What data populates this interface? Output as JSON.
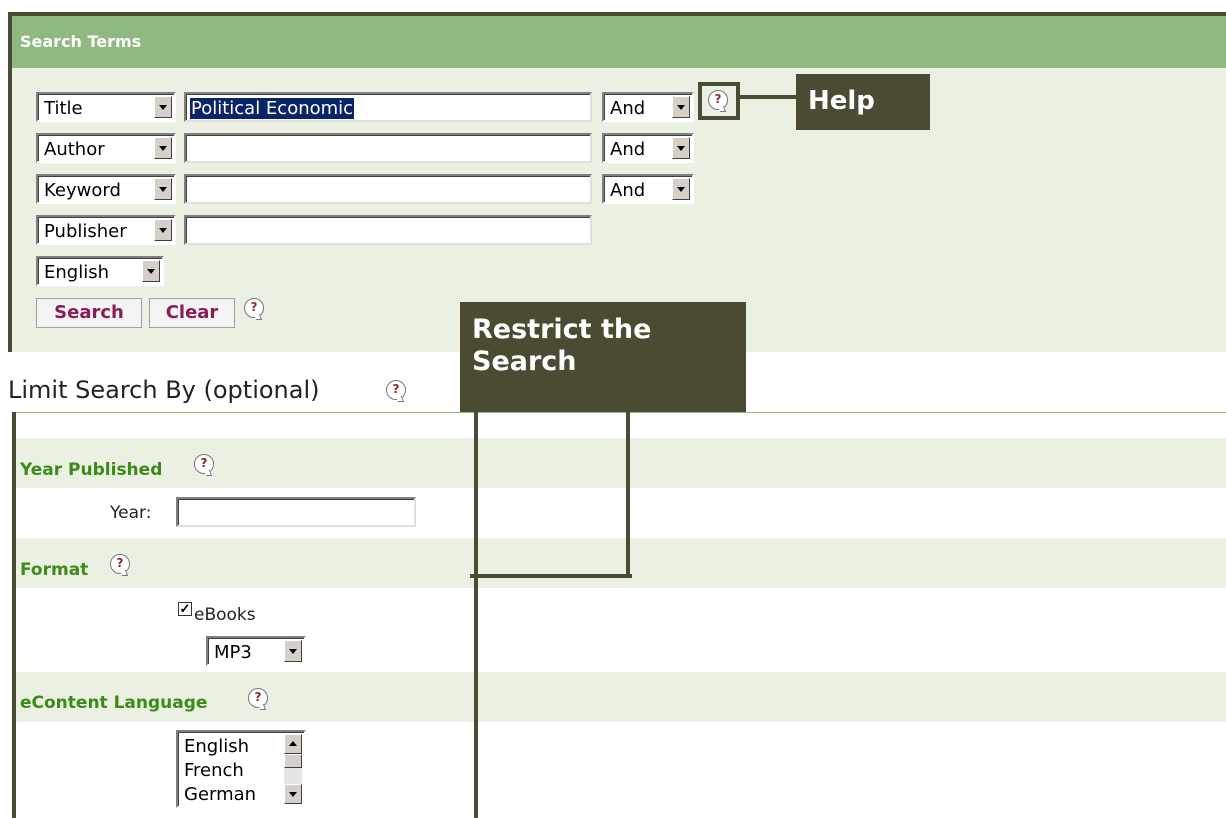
{
  "search_terms": {
    "title": "Search Terms",
    "rows": [
      {
        "field": "Title",
        "value": "Political Economic",
        "operator": "And"
      },
      {
        "field": "Author",
        "value": "",
        "operator": "And"
      },
      {
        "field": "Keyword",
        "value": "",
        "operator": "And"
      },
      {
        "field": "Publisher",
        "value": ""
      }
    ],
    "language": "English",
    "search_label": "Search",
    "clear_label": "Clear"
  },
  "callouts": {
    "help": "Help",
    "restrict_line1": "Restrict the",
    "restrict_line2": "Search"
  },
  "limit": {
    "title": "Limit Search By (optional)",
    "year_published": {
      "label": "Year Published",
      "year_label": "Year:",
      "year_value": ""
    },
    "format": {
      "label": "Format",
      "ebooks_label": "eBooks",
      "ebooks_checked": true,
      "type": "MP3"
    },
    "econtent_language": {
      "label": "eContent Language",
      "options": [
        "English",
        "French",
        "German"
      ]
    }
  },
  "colors": {
    "header_green": "#8fb981",
    "panel_bg": "#eaf1e2",
    "callout_bg": "#4a4b32",
    "section_label": "#3c8a1a",
    "button_text": "#8b1c55"
  },
  "icons": {
    "help": "help-icon"
  }
}
